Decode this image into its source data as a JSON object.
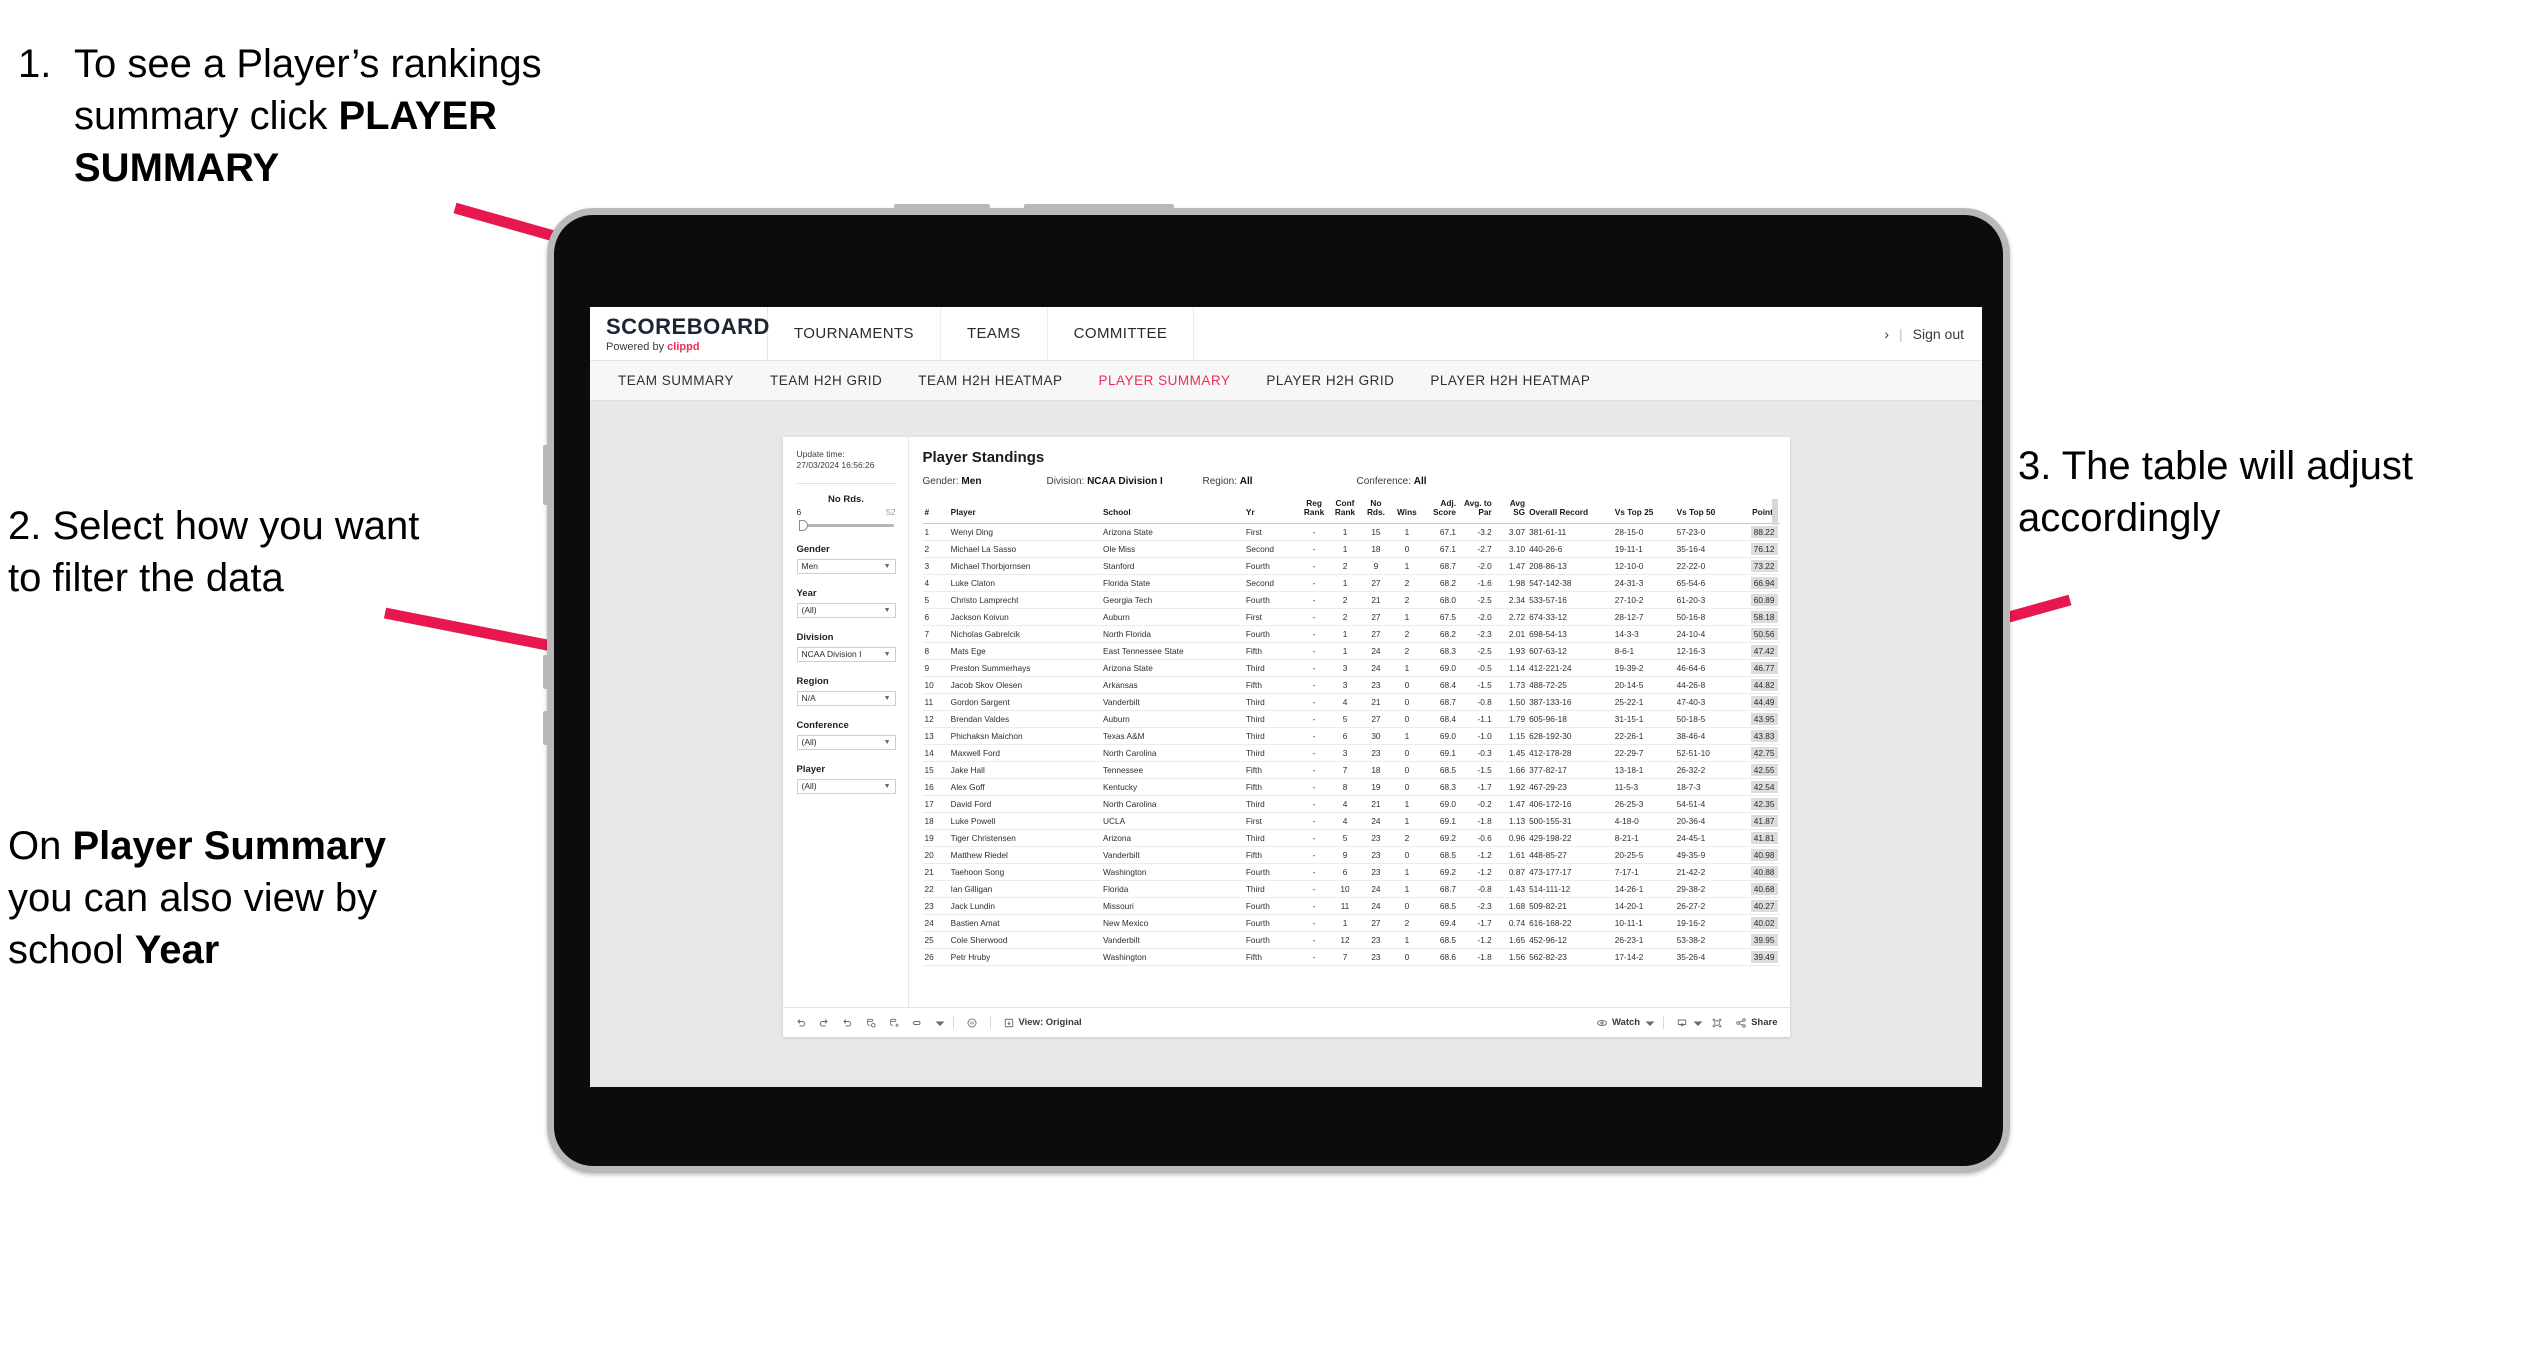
{
  "annotations": {
    "step1": {
      "number": "1.",
      "text_before": "To see a Player’s rankings summary click ",
      "bold": "PLAYER SUMMARY"
    },
    "step2": {
      "text": "2. Select how you want to filter the data"
    },
    "step2b": {
      "pre": "On ",
      "bold1": "Player Summary",
      "mid": " you can also view by school ",
      "bold2": "Year"
    },
    "step3": {
      "text": "3. The table will adjust accordingly"
    },
    "arrow_color": "#e8184f"
  },
  "app": {
    "brand": {
      "name": "SCOREBOARD",
      "powered_prefix": "Powered by ",
      "powered_brand": "clippd"
    },
    "top_nav": [
      "TOURNAMENTS",
      "TEAMS",
      "COMMITTEE"
    ],
    "top_right": {
      "chevron": "›",
      "divider": "|",
      "sign_out": "Sign out"
    },
    "sub_nav": [
      {
        "label": "TEAM SUMMARY",
        "active": false
      },
      {
        "label": "TEAM H2H GRID",
        "active": false
      },
      {
        "label": "TEAM H2H HEATMAP",
        "active": false
      },
      {
        "label": "PLAYER SUMMARY",
        "active": true
      },
      {
        "label": "PLAYER H2H GRID",
        "active": false
      },
      {
        "label": "PLAYER H2H HEATMAP",
        "active": false
      }
    ],
    "accent_color": "#ef2d56"
  },
  "filters": {
    "update_label": "Update time:",
    "update_value": "27/03/2024 16:56:26",
    "slider": {
      "label": "No Rds.",
      "min": "6",
      "max": "52"
    },
    "selects": [
      {
        "label": "Gender",
        "value": "Men"
      },
      {
        "label": "Year",
        "value": "(All)"
      },
      {
        "label": "Division",
        "value": "NCAA Division I"
      },
      {
        "label": "Region",
        "value": "N/A"
      },
      {
        "label": "Conference",
        "value": "(All)"
      },
      {
        "label": "Player",
        "value": "(All)"
      }
    ]
  },
  "viz": {
    "title": "Player Standings",
    "subheaders": [
      {
        "key": "Gender:",
        "value": "Men"
      },
      {
        "key": "Division:",
        "value": "NCAA Division I"
      },
      {
        "key": "Region:",
        "value": "All"
      },
      {
        "key": "Conference:",
        "value": "All"
      }
    ],
    "columns": [
      "#",
      "Player",
      "School",
      "Yr",
      "Reg Rank",
      "Conf Rank",
      "No Rds.",
      "Wins",
      "Adj. Score",
      "Avg. to Par",
      "Avg SG",
      "Overall Record",
      "Vs Top 25",
      "Vs Top 50",
      "Points"
    ],
    "rows": [
      [
        "1",
        "Wenyi Ding",
        "Arizona State",
        "First",
        "-",
        "1",
        "15",
        "1",
        "67.1",
        "-3.2",
        "3.07",
        "381-61-11",
        "28-15-0",
        "57-23-0",
        "88.22"
      ],
      [
        "2",
        "Michael La Sasso",
        "Ole Miss",
        "Second",
        "-",
        "1",
        "18",
        "0",
        "67.1",
        "-2.7",
        "3.10",
        "440-26-6",
        "19-11-1",
        "35-16-4",
        "76.12"
      ],
      [
        "3",
        "Michael Thorbjornsen",
        "Stanford",
        "Fourth",
        "-",
        "2",
        "9",
        "1",
        "68.7",
        "-2.0",
        "1.47",
        "208-86-13",
        "12-10-0",
        "22-22-0",
        "73.22"
      ],
      [
        "4",
        "Luke Claton",
        "Florida State",
        "Second",
        "-",
        "1",
        "27",
        "2",
        "68.2",
        "-1.6",
        "1.98",
        "547-142-38",
        "24-31-3",
        "65-54-6",
        "66.94"
      ],
      [
        "5",
        "Christo Lamprecht",
        "Georgia Tech",
        "Fourth",
        "-",
        "2",
        "21",
        "2",
        "68.0",
        "-2.5",
        "2.34",
        "533-57-16",
        "27-10-2",
        "61-20-3",
        "60.89"
      ],
      [
        "6",
        "Jackson Koivun",
        "Auburn",
        "First",
        "-",
        "2",
        "27",
        "1",
        "67.5",
        "-2.0",
        "2.72",
        "674-33-12",
        "28-12-7",
        "50-16-8",
        "58.18"
      ],
      [
        "7",
        "Nicholas Gabrelcik",
        "North Florida",
        "Fourth",
        "-",
        "1",
        "27",
        "2",
        "68.2",
        "-2.3",
        "2.01",
        "698-54-13",
        "14-3-3",
        "24-10-4",
        "50.56"
      ],
      [
        "8",
        "Mats Ege",
        "East Tennessee State",
        "Fifth",
        "-",
        "1",
        "24",
        "2",
        "68.3",
        "-2.5",
        "1.93",
        "607-63-12",
        "8-6-1",
        "12-16-3",
        "47.42"
      ],
      [
        "9",
        "Preston Summerhays",
        "Arizona State",
        "Third",
        "-",
        "3",
        "24",
        "1",
        "69.0",
        "-0.5",
        "1.14",
        "412-221-24",
        "19-39-2",
        "46-64-6",
        "46.77"
      ],
      [
        "10",
        "Jacob Skov Olesen",
        "Arkansas",
        "Fifth",
        "-",
        "3",
        "23",
        "0",
        "68.4",
        "-1.5",
        "1.73",
        "488-72-25",
        "20-14-5",
        "44-26-8",
        "44.82"
      ],
      [
        "11",
        "Gordon Sargent",
        "Vanderbilt",
        "Third",
        "-",
        "4",
        "21",
        "0",
        "68.7",
        "-0.8",
        "1.50",
        "387-133-16",
        "25-22-1",
        "47-40-3",
        "44.49"
      ],
      [
        "12",
        "Brendan Valdes",
        "Auburn",
        "Third",
        "-",
        "5",
        "27",
        "0",
        "68.4",
        "-1.1",
        "1.79",
        "605-96-18",
        "31-15-1",
        "50-18-5",
        "43.95"
      ],
      [
        "13",
        "Phichaksn Maichon",
        "Texas A&M",
        "Third",
        "-",
        "6",
        "30",
        "1",
        "69.0",
        "-1.0",
        "1.15",
        "628-192-30",
        "22-26-1",
        "38-46-4",
        "43.83"
      ],
      [
        "14",
        "Maxwell Ford",
        "North Carolina",
        "Third",
        "-",
        "3",
        "23",
        "0",
        "69.1",
        "-0.3",
        "1.45",
        "412-178-28",
        "22-29-7",
        "52-51-10",
        "42.75"
      ],
      [
        "15",
        "Jake Hall",
        "Tennessee",
        "Fifth",
        "-",
        "7",
        "18",
        "0",
        "68.5",
        "-1.5",
        "1.66",
        "377-82-17",
        "13-18-1",
        "26-32-2",
        "42.55"
      ],
      [
        "16",
        "Alex Goff",
        "Kentucky",
        "Fifth",
        "-",
        "8",
        "19",
        "0",
        "68.3",
        "-1.7",
        "1.92",
        "467-29-23",
        "11-5-3",
        "18-7-3",
        "42.54"
      ],
      [
        "17",
        "David Ford",
        "North Carolina",
        "Third",
        "-",
        "4",
        "21",
        "1",
        "69.0",
        "-0.2",
        "1.47",
        "406-172-16",
        "26-25-3",
        "54-51-4",
        "42.35"
      ],
      [
        "18",
        "Luke Powell",
        "UCLA",
        "First",
        "-",
        "4",
        "24",
        "1",
        "69.1",
        "-1.8",
        "1.13",
        "500-155-31",
        "4-18-0",
        "20-36-4",
        "41.87"
      ],
      [
        "19",
        "Tiger Christensen",
        "Arizona",
        "Third",
        "-",
        "5",
        "23",
        "2",
        "69.2",
        "-0.6",
        "0.96",
        "429-198-22",
        "8-21-1",
        "24-45-1",
        "41.81"
      ],
      [
        "20",
        "Matthew Riedel",
        "Vanderbilt",
        "Fifth",
        "-",
        "9",
        "23",
        "0",
        "68.5",
        "-1.2",
        "1.61",
        "448-85-27",
        "20-25-5",
        "49-35-9",
        "40.98"
      ],
      [
        "21",
        "Taehoon Song",
        "Washington",
        "Fourth",
        "-",
        "6",
        "23",
        "1",
        "69.2",
        "-1.2",
        "0.87",
        "473-177-17",
        "7-17-1",
        "21-42-2",
        "40.88"
      ],
      [
        "22",
        "Ian Gilligan",
        "Florida",
        "Third",
        "-",
        "10",
        "24",
        "1",
        "68.7",
        "-0.8",
        "1.43",
        "514-111-12",
        "14-26-1",
        "29-38-2",
        "40.68"
      ],
      [
        "23",
        "Jack Lundin",
        "Missouri",
        "Fourth",
        "-",
        "11",
        "24",
        "0",
        "68.5",
        "-2.3",
        "1.68",
        "509-82-21",
        "14-20-1",
        "26-27-2",
        "40.27"
      ],
      [
        "24",
        "Bastien Amat",
        "New Mexico",
        "Fourth",
        "-",
        "1",
        "27",
        "2",
        "69.4",
        "-1.7",
        "0.74",
        "616-168-22",
        "10-11-1",
        "19-16-2",
        "40.02"
      ],
      [
        "25",
        "Cole Sherwood",
        "Vanderbilt",
        "Fourth",
        "-",
        "12",
        "23",
        "1",
        "68.5",
        "-1.2",
        "1.65",
        "452-96-12",
        "26-23-1",
        "53-38-2",
        "39.95"
      ],
      [
        "26",
        "Petr Hruby",
        "Washington",
        "Fifth",
        "-",
        "7",
        "23",
        "0",
        "68.6",
        "-1.8",
        "1.56",
        "562-82-23",
        "17-14-2",
        "35-26-4",
        "39.49"
      ]
    ]
  },
  "toolbar": {
    "view_label": "View: Original",
    "watch_label": "Watch",
    "share_label": "Share"
  }
}
